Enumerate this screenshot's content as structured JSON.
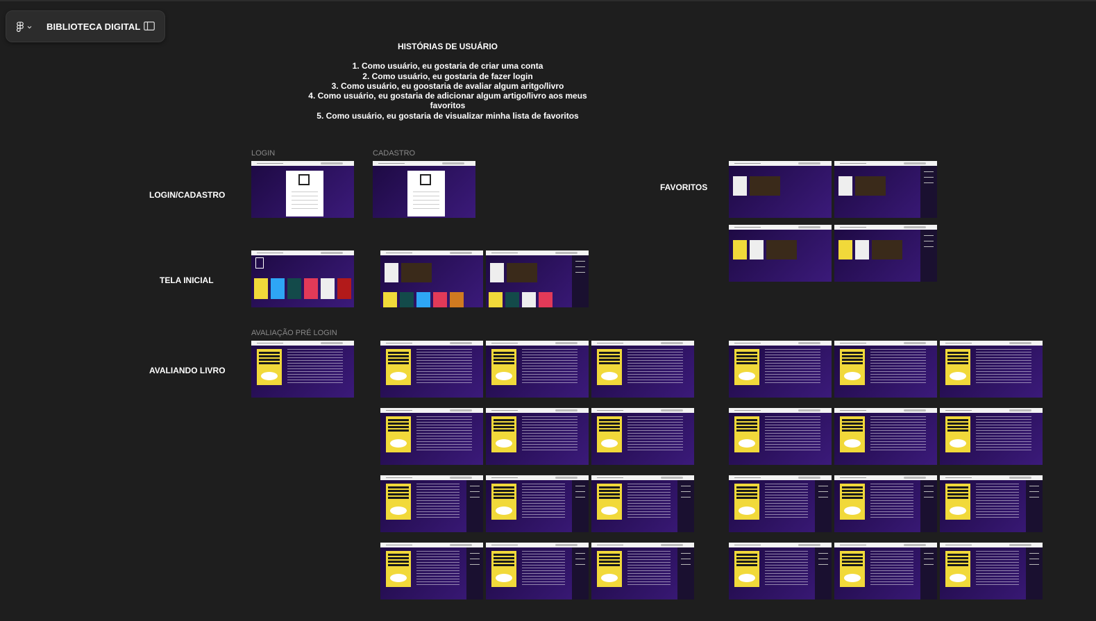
{
  "toolbar": {
    "title": "BIBLIOTECA DIGITAL",
    "logo_icon": "figma-icon",
    "chevron_icon": "chevron-down-icon",
    "panel_icon": "sidebar-toggle-icon"
  },
  "stories": {
    "title": "HISTÓRIAS DE USUÁRIO",
    "items": [
      "1. Como usuário, eu gostaria de criar uma conta",
      "2. Como usuário, eu gostaria de fazer login",
      "3. Como usuário, eu goostaria de avaliar algum aritgo/livro",
      "4. Como usuário, eu gostaria de adicionar algum artigo/livro aos meus favoritos",
      "5. Como usuário, eu gostaria de visualizar minha lista de favoritos"
    ]
  },
  "rows": {
    "login": "LOGIN/CADASTRO",
    "home": "TELA INICIAL",
    "rating": "AVALIANDO LIVRO",
    "favorites": "FAVORITOS"
  },
  "frame_labels": {
    "login": "LOGIN",
    "signup": "CADASTRO",
    "rating_prelogin": "AVALIAÇÃO PRÉ LOGIN"
  },
  "colors": {
    "canvas": "#1e1e1e",
    "frame_bg": "#2a0f5a",
    "book_cover": "#f1d93a"
  }
}
